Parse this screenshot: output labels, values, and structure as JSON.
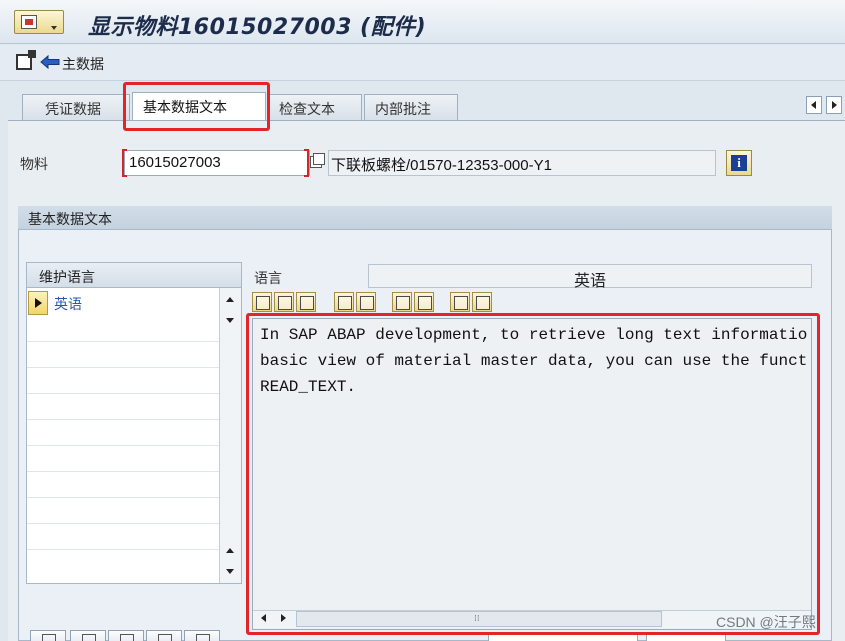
{
  "window": {
    "title": "显示物料16015027003 (配件)"
  },
  "toolbar": {
    "main_data_label": "主数据",
    "icons": [
      "other-object-icon",
      "back-arrow-icon"
    ]
  },
  "tabs": [
    {
      "label": "凭证数据",
      "active": false
    },
    {
      "label": "基本数据文本",
      "active": true
    },
    {
      "label": "检查文本",
      "active": false
    },
    {
      "label": "内部批注",
      "active": false
    }
  ],
  "material": {
    "label": "物料",
    "number": "16015027003",
    "description": "下联板螺栓/01570-12353-000-Y1"
  },
  "group": {
    "title": "基本数据文本"
  },
  "languages": {
    "header": "维护语言",
    "items": [
      "英语"
    ]
  },
  "language_field": {
    "label": "语言",
    "value": "英语"
  },
  "editor": {
    "lines": [
      "In SAP ABAP development, to retrieve long text informatio",
      "basic view of material master data, you can use the funct",
      "READ_TEXT."
    ]
  },
  "watermark": "CSDN @汪子熙",
  "colors": {
    "highlight": "#e1252a",
    "title": "#1d2c4a",
    "link": "#2659a8"
  }
}
